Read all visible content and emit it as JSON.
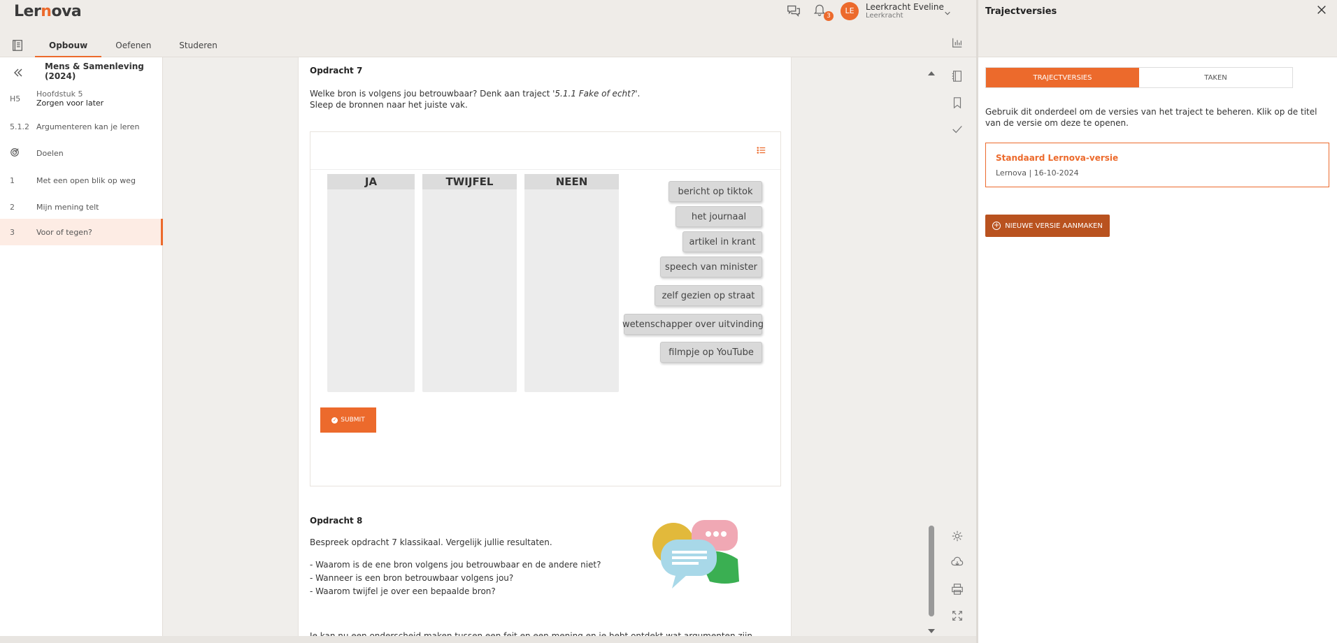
{
  "app": {
    "logo": "Lernova",
    "logo_first": "Ler",
    "logo_accent": "n",
    "logo_rest": "ova"
  },
  "topbar": {
    "notification_count": "3",
    "user": {
      "initials": "LE",
      "name": "Leerkracht Eveline",
      "role": "Leerkracht"
    }
  },
  "tabs": [
    {
      "label": "Opbouw",
      "active": true
    },
    {
      "label": "Oefenen",
      "active": false
    },
    {
      "label": "Studeren",
      "active": false
    }
  ],
  "sidebar": {
    "title": "Mens & Samenleving (2024)",
    "chapter": {
      "num": "H5",
      "label1": "Hoofdstuk 5",
      "label2": "Zorgen voor later"
    },
    "items": [
      {
        "num": "5.1.2",
        "label": "Argumenteren kan je leren",
        "active": false
      },
      {
        "num": "",
        "label": "Doelen",
        "active": false
      },
      {
        "num": "1",
        "label": "Met een open blik op weg",
        "active": false
      },
      {
        "num": "2",
        "label": "Mijn mening telt",
        "active": false
      },
      {
        "num": "3",
        "label": "Voor of tegen?",
        "active": true
      }
    ]
  },
  "content": {
    "opdracht7": {
      "title": "Opdracht 7",
      "line1_start": "Welke bron is volgens jou betrouwbaar? Denk aan traject ",
      "line1_italic": "'5.1.1 Fake of echt?'",
      "line1_end": ".",
      "line2": "Sleep de bronnen naar het juiste vak."
    },
    "buckets": [
      "JA",
      "TWIJFEL",
      "NEEN"
    ],
    "chips": [
      "bericht op tiktok",
      "het journaal",
      "artikel in krant",
      "speech van minister",
      "zelf gezien op straat",
      "wetenschapper over uitvinding",
      "filmpje op YouTube"
    ],
    "submit_label": "SUBMIT",
    "opdracht8": {
      "title": "Opdracht 8",
      "intro": "Bespreek opdracht 7 klassikaal. Vergelijk jullie resultaten.",
      "questions": [
        "- Waarom is de ene bron volgens jou betrouwbaar en de andere niet?",
        "- Wanneer is een bron betrouwbaar volgens jou?",
        "- Waarom twijfel je over een bepaalde bron?"
      ],
      "footer": "Je kan nu een onderscheid maken tussen een feit en een mening en je hebt ontdekt wat argumenten zijn."
    }
  },
  "panel": {
    "title": "Trajectversies",
    "segments": [
      {
        "label": "TRAJECTVERSIES",
        "active": true
      },
      {
        "label": "TAKEN",
        "active": false
      }
    ],
    "description": "Gebruik dit onderdeel om de versies van het traject te beheren. Klik op de titel van de versie om deze te openen.",
    "version": {
      "title": "Standaard Lernova-versie",
      "meta": "Lernova | 16-10-2024"
    },
    "new_button": "NIEUWE VERSIE AANMAKEN"
  },
  "colors": {
    "accent": "#ec6a2c",
    "accent_dark": "#b9521f",
    "active_row": "#fdece4"
  }
}
